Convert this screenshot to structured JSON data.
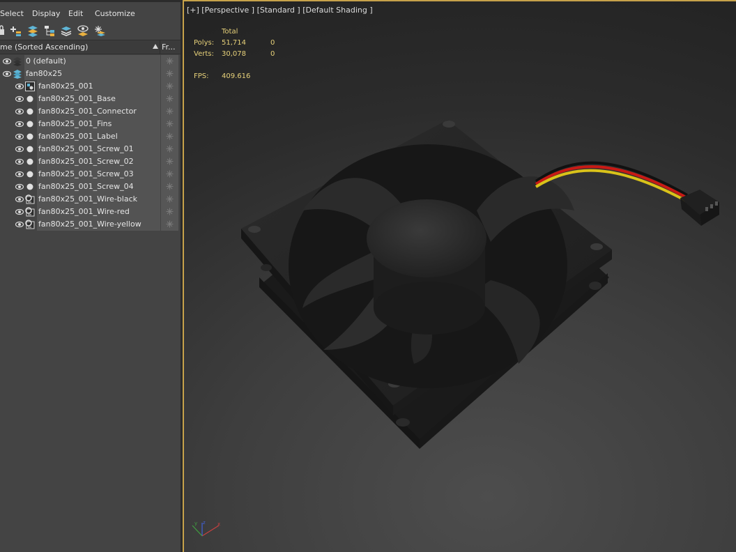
{
  "menu": {
    "select": "Select",
    "display": "Display",
    "edit": "Edit",
    "customize": "Customize"
  },
  "toolbar_icons": [
    "lock-icon",
    "add-icon",
    "layers-icon",
    "hierarchy-icon",
    "layer-stack-icon",
    "layer-visibility-icon",
    "layer-freeze-icon"
  ],
  "explorer": {
    "column_name": "me (Sorted Ascending)",
    "column_frozen": "Fr..."
  },
  "rows": [
    {
      "label": "0 (default)",
      "type": "layer",
      "level": 0
    },
    {
      "label": "fan80x25",
      "type": "layer-active",
      "level": 0
    },
    {
      "label": "fan80x25_001",
      "type": "group",
      "level": 1
    },
    {
      "label": "fan80x25_001_Base",
      "type": "mesh",
      "level": 1
    },
    {
      "label": "fan80x25_001_Connector",
      "type": "mesh",
      "level": 1
    },
    {
      "label": "fan80x25_001_Fins",
      "type": "mesh",
      "level": 1
    },
    {
      "label": "fan80x25_001_Label",
      "type": "mesh",
      "level": 1
    },
    {
      "label": "fan80x25_001_Screw_01",
      "type": "mesh",
      "level": 1
    },
    {
      "label": "fan80x25_001_Screw_02",
      "type": "mesh",
      "level": 1
    },
    {
      "label": "fan80x25_001_Screw_03",
      "type": "mesh",
      "level": 1
    },
    {
      "label": "fan80x25_001_Screw_04",
      "type": "mesh",
      "level": 1
    },
    {
      "label": "fan80x25_001_Wire-black",
      "type": "spline",
      "level": 1
    },
    {
      "label": "fan80x25_001_Wire-red",
      "type": "spline",
      "level": 1
    },
    {
      "label": "fan80x25_001_Wire-yellow",
      "type": "spline",
      "level": 1
    }
  ],
  "viewport": {
    "label": "[+] [Perspective ] [Standard ] [Default Shading ]",
    "stats": {
      "total_header": "Total",
      "polys_label": "Polys:",
      "polys_total": "51,714",
      "polys_sel": "0",
      "verts_label": "Verts:",
      "verts_total": "30,078",
      "verts_sel": "0",
      "fps_label": "FPS:",
      "fps_value": "409.616"
    },
    "stats_color": "#e8d27a",
    "active_border_color": "#c7a24a",
    "wire_colors": {
      "black": "#111111",
      "red": "#c81a14",
      "yellow": "#d9c21a"
    },
    "gizmo_axes": {
      "x": "x",
      "y": "y",
      "z": "z"
    }
  }
}
